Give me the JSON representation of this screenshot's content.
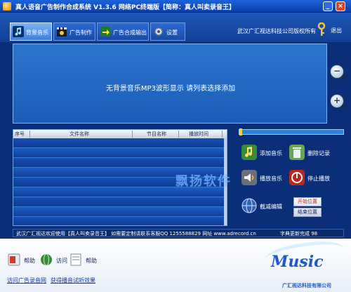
{
  "window": {
    "title": "真人语音广告制作合成系统  V1.3.6  网络PC终端版【简称：真人叫卖录音王】",
    "minimize_label": "_",
    "close_label": "×"
  },
  "tabs": [
    {
      "label": "背景音乐",
      "icon": "music-note-icon",
      "active": true
    },
    {
      "label": "广告制作",
      "icon": "film-clapper-icon",
      "active": false
    },
    {
      "label": "广告合成输出",
      "icon": "output-icon",
      "active": false
    },
    {
      "label": "设置",
      "icon": "gear-icon",
      "active": false
    }
  ],
  "header": {
    "copyright": "武汉广汇视达科技公司版权所有",
    "exit_label": "退出"
  },
  "waveform": {
    "message": "无背景音乐MP3波形显示 请列表选择添加",
    "zoom_out_label": "−",
    "zoom_in_label": "+"
  },
  "playlist": {
    "columns": [
      "序号",
      "文件名称",
      "节目名称",
      "播放时间"
    ],
    "rows": []
  },
  "playback": {
    "progress": 0.02
  },
  "actions": {
    "add_music": "添加音乐",
    "delete_record": "删除记录",
    "play_music": "播放音乐",
    "stop_play": "停止播放",
    "cut_edit": "截减编辑",
    "start_position": "开始位置",
    "end_position": "结束位置"
  },
  "watermark": "飘扬软件",
  "status": {
    "left": "武汉广汇视达欢迎使用【真人叫卖录音王】 如需要定制请联系客服QQ 1255588829 网址 www.adrecord.cn",
    "right": "字典更新完成 98"
  },
  "footer": {
    "buttons": [
      {
        "label": "帮助",
        "icon": "help-book-icon"
      },
      {
        "label": "访问",
        "icon": "globe-icon"
      },
      {
        "label": "帮助",
        "icon": "document-icon"
      }
    ],
    "links": [
      "访问广告录音网",
      "获得播音试听效果"
    ],
    "logo_text": "Music",
    "logo_caption": "广汇视达科技有限公司"
  },
  "colors": {
    "window_bg": "#0a2f78",
    "panel_blue": "#1a5cb8",
    "accent_red": "#c0241f",
    "logo_blue": "#1d59c9"
  }
}
